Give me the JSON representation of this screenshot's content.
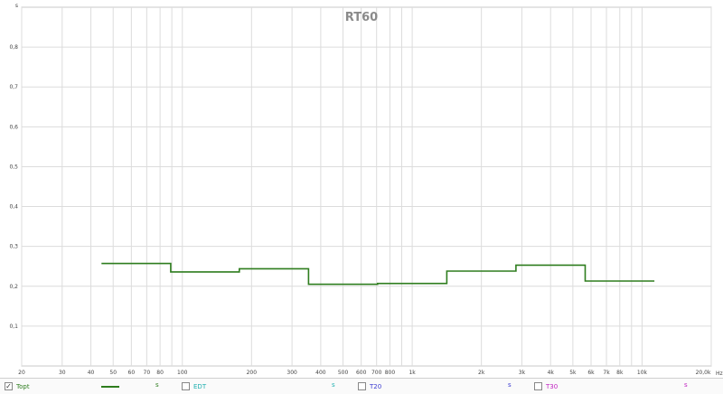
{
  "chart_data": {
    "type": "line",
    "title": "RT60",
    "xscale": "log",
    "xlim": [
      20,
      20000
    ],
    "ylim": [
      0,
      0.9
    ],
    "grid": true,
    "y_unit": "s",
    "x_unit": "Hz",
    "yticks": [
      {
        "v": 0.1,
        "label": "0,1"
      },
      {
        "v": 0.2,
        "label": "0,2"
      },
      {
        "v": 0.3,
        "label": "0,3"
      },
      {
        "v": 0.4,
        "label": "0,4"
      },
      {
        "v": 0.5,
        "label": "0,5"
      },
      {
        "v": 0.6,
        "label": "0,6"
      },
      {
        "v": 0.7,
        "label": "0,7"
      },
      {
        "v": 0.8,
        "label": "0,8"
      }
    ],
    "xticks": [
      {
        "v": 20,
        "label": "20"
      },
      {
        "v": 30,
        "label": "30"
      },
      {
        "v": 40,
        "label": "40"
      },
      {
        "v": 50,
        "label": "50"
      },
      {
        "v": 60,
        "label": "60"
      },
      {
        "v": 70,
        "label": "70"
      },
      {
        "v": 80,
        "label": "80"
      },
      {
        "v": 100,
        "label": "100"
      },
      {
        "v": 200,
        "label": "200"
      },
      {
        "v": 300,
        "label": "300"
      },
      {
        "v": 400,
        "label": "400"
      },
      {
        "v": 500,
        "label": "500"
      },
      {
        "v": 600,
        "label": "600"
      },
      {
        "v": 700,
        "label": "700"
      },
      {
        "v": 800,
        "label": "800"
      },
      {
        "v": 1000,
        "label": "1k"
      },
      {
        "v": 2000,
        "label": "2k"
      },
      {
        "v": 3000,
        "label": "3k"
      },
      {
        "v": 4000,
        "label": "4k"
      },
      {
        "v": 5000,
        "label": "5k"
      },
      {
        "v": 6000,
        "label": "6k"
      },
      {
        "v": 7000,
        "label": "7k"
      },
      {
        "v": 8000,
        "label": "8k"
      },
      {
        "v": 10000,
        "label": "10k"
      },
      {
        "v": 20000,
        "label": "20,0k"
      }
    ],
    "grid_x": [
      20,
      30,
      40,
      50,
      60,
      70,
      80,
      90,
      100,
      200,
      300,
      400,
      500,
      600,
      700,
      800,
      900,
      1000,
      2000,
      3000,
      4000,
      5000,
      6000,
      7000,
      8000,
      9000,
      10000,
      20000
    ],
    "series": [
      {
        "name": "Topt",
        "color": "#2e7d1e",
        "steps": [
          {
            "f_lo": 44.5,
            "f_hi": 89,
            "v": 0.257
          },
          {
            "f_lo": 89,
            "f_hi": 177,
            "v": 0.236
          },
          {
            "f_lo": 177,
            "f_hi": 354,
            "v": 0.244
          },
          {
            "f_lo": 354,
            "f_hi": 707,
            "v": 0.205
          },
          {
            "f_lo": 707,
            "f_hi": 1414,
            "v": 0.207
          },
          {
            "f_lo": 1414,
            "f_hi": 2828,
            "v": 0.238
          },
          {
            "f_lo": 2828,
            "f_hi": 5657,
            "v": 0.253
          },
          {
            "f_lo": 5657,
            "f_hi": 11314,
            "v": 0.213
          }
        ]
      }
    ]
  },
  "legend": {
    "items": [
      {
        "label": "Topt",
        "unit": "s",
        "color": "#2e7d1e",
        "checked": true,
        "check_glyph": "✓"
      },
      {
        "label": "EDT",
        "unit": "s",
        "color": "#1fb0b0",
        "checked": false,
        "check_glyph": ""
      },
      {
        "label": "T20",
        "unit": "s",
        "color": "#3a3ad0",
        "checked": false,
        "check_glyph": ""
      },
      {
        "label": "T30",
        "unit": "s",
        "color": "#c020c0",
        "checked": false,
        "check_glyph": ""
      }
    ]
  }
}
